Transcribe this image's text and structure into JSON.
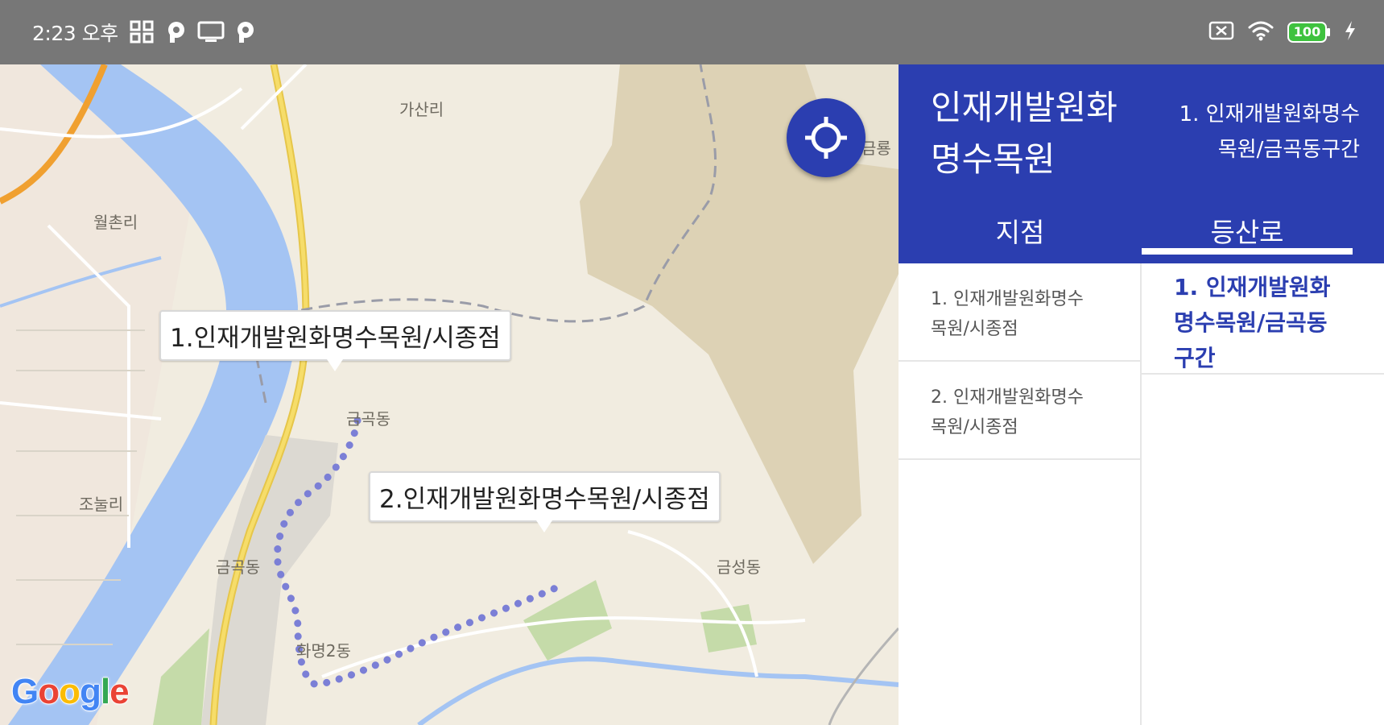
{
  "status_bar": {
    "time": "2:23 오후",
    "battery": "100",
    "left_icons": [
      "apps-icon",
      "parking-icon",
      "screen-icon",
      "parking-icon"
    ],
    "right_icons": [
      "sim-icon",
      "wifi-icon",
      "battery-icon",
      "charging-icon"
    ]
  },
  "map": {
    "places": [
      "가산리",
      "월촌리",
      "금곡동",
      "조눌리",
      "금곡동",
      "금성동",
      "화명2동",
      "금룡"
    ],
    "callouts": [
      "1.인재개발원화명수목원/시종점",
      "2.인재개발원화명수목원/시종점"
    ],
    "logo": "Google",
    "route_color": "#7b7fd6"
  },
  "panel": {
    "title": "인재개발원화\n명수목원",
    "subtitle": "1. 인재개발원화명수\n목원/금곡동구간",
    "tabs": [
      {
        "label": "지점",
        "selected": false
      },
      {
        "label": "등산로",
        "selected": true
      }
    ],
    "spots": [
      "1. 인재개발원화명수\n목원/시종점",
      "2. 인재개발원화명수\n목원/시종점"
    ],
    "trails": [
      "1. 인재개발원화\n명수목원/금곡동\n구간"
    ]
  },
  "colors": {
    "accent": "#2b3eb0",
    "status_bar": "#777777",
    "water": "#a4c4f3",
    "park": "#ddd2b5"
  }
}
